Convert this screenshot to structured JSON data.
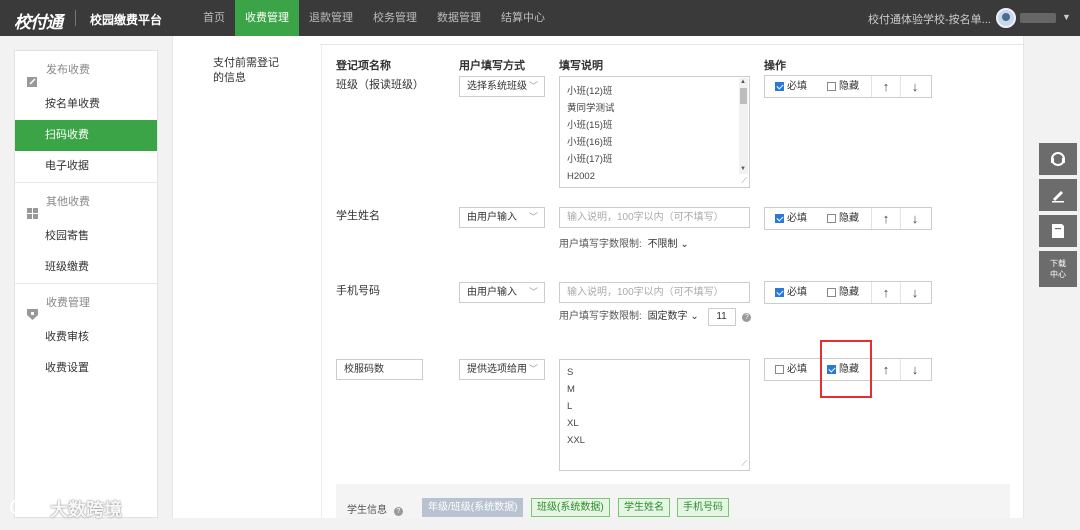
{
  "header": {
    "logo": "校付通",
    "platform": "校园缴费平台",
    "nav": [
      "首页",
      "收费管理",
      "退款管理",
      "校务管理",
      "数据管理",
      "结算中心"
    ],
    "active_nav": 1,
    "school": "校付通体验学校-按名单..."
  },
  "sidebar": {
    "groups": [
      {
        "title": "发布收费",
        "icon": "edit-icon",
        "items": [
          "按名单收费",
          "扫码收费",
          "电子收据"
        ]
      },
      {
        "title": "其他收费",
        "icon": "grid-icon",
        "items": [
          "校园寄售",
          "班级缴费"
        ]
      },
      {
        "title": "收费管理",
        "icon": "shield-icon",
        "items": [
          "收费审核",
          "收费设置"
        ]
      }
    ],
    "active_item": "扫码收费"
  },
  "section_label": "支付前需登记的信息",
  "columns": {
    "name": "登记项名称",
    "method": "用户填写方式",
    "desc": "填写说明",
    "ops": "操作"
  },
  "ops_labels": {
    "required": "必填",
    "hidden": "隐藏",
    "up": "↑",
    "down": "↓"
  },
  "fields": [
    {
      "name": "班级（报读班级）",
      "method": "选择系统班级",
      "options": [
        "小班(12)班",
        "黄同学测试",
        "小班(15)班",
        "小班(16)班",
        "小班(17)班",
        "H2002"
      ],
      "required": true,
      "hidden": false
    },
    {
      "name": "学生姓名",
      "method": "由用户输入",
      "placeholder": "输入说明，100字以内（可不填写）",
      "limit_label": "用户填写字数限制:",
      "limit_value": "不限制",
      "required": true,
      "hidden": false
    },
    {
      "name": "手机号码",
      "method": "由用户输入",
      "placeholder": "输入说明，100字以内（可不填写）",
      "limit_label": "用户填写字数限制:",
      "limit_value": "固定数字",
      "limit_number": "11",
      "required": true,
      "hidden": false
    },
    {
      "name": "校服码数",
      "method": "提供选项给用",
      "options": [
        "S",
        "M",
        "L",
        "XL",
        "XXL"
      ],
      "required": false,
      "hidden": true
    }
  ],
  "student_info": {
    "label": "学生信息",
    "tags": [
      "年级/班级(系统数据)",
      "班级(系统数据)",
      "学生姓名",
      "手机号码"
    ]
  },
  "right_tools": {
    "download": "下载中心"
  },
  "watermark": "大数跨境"
}
